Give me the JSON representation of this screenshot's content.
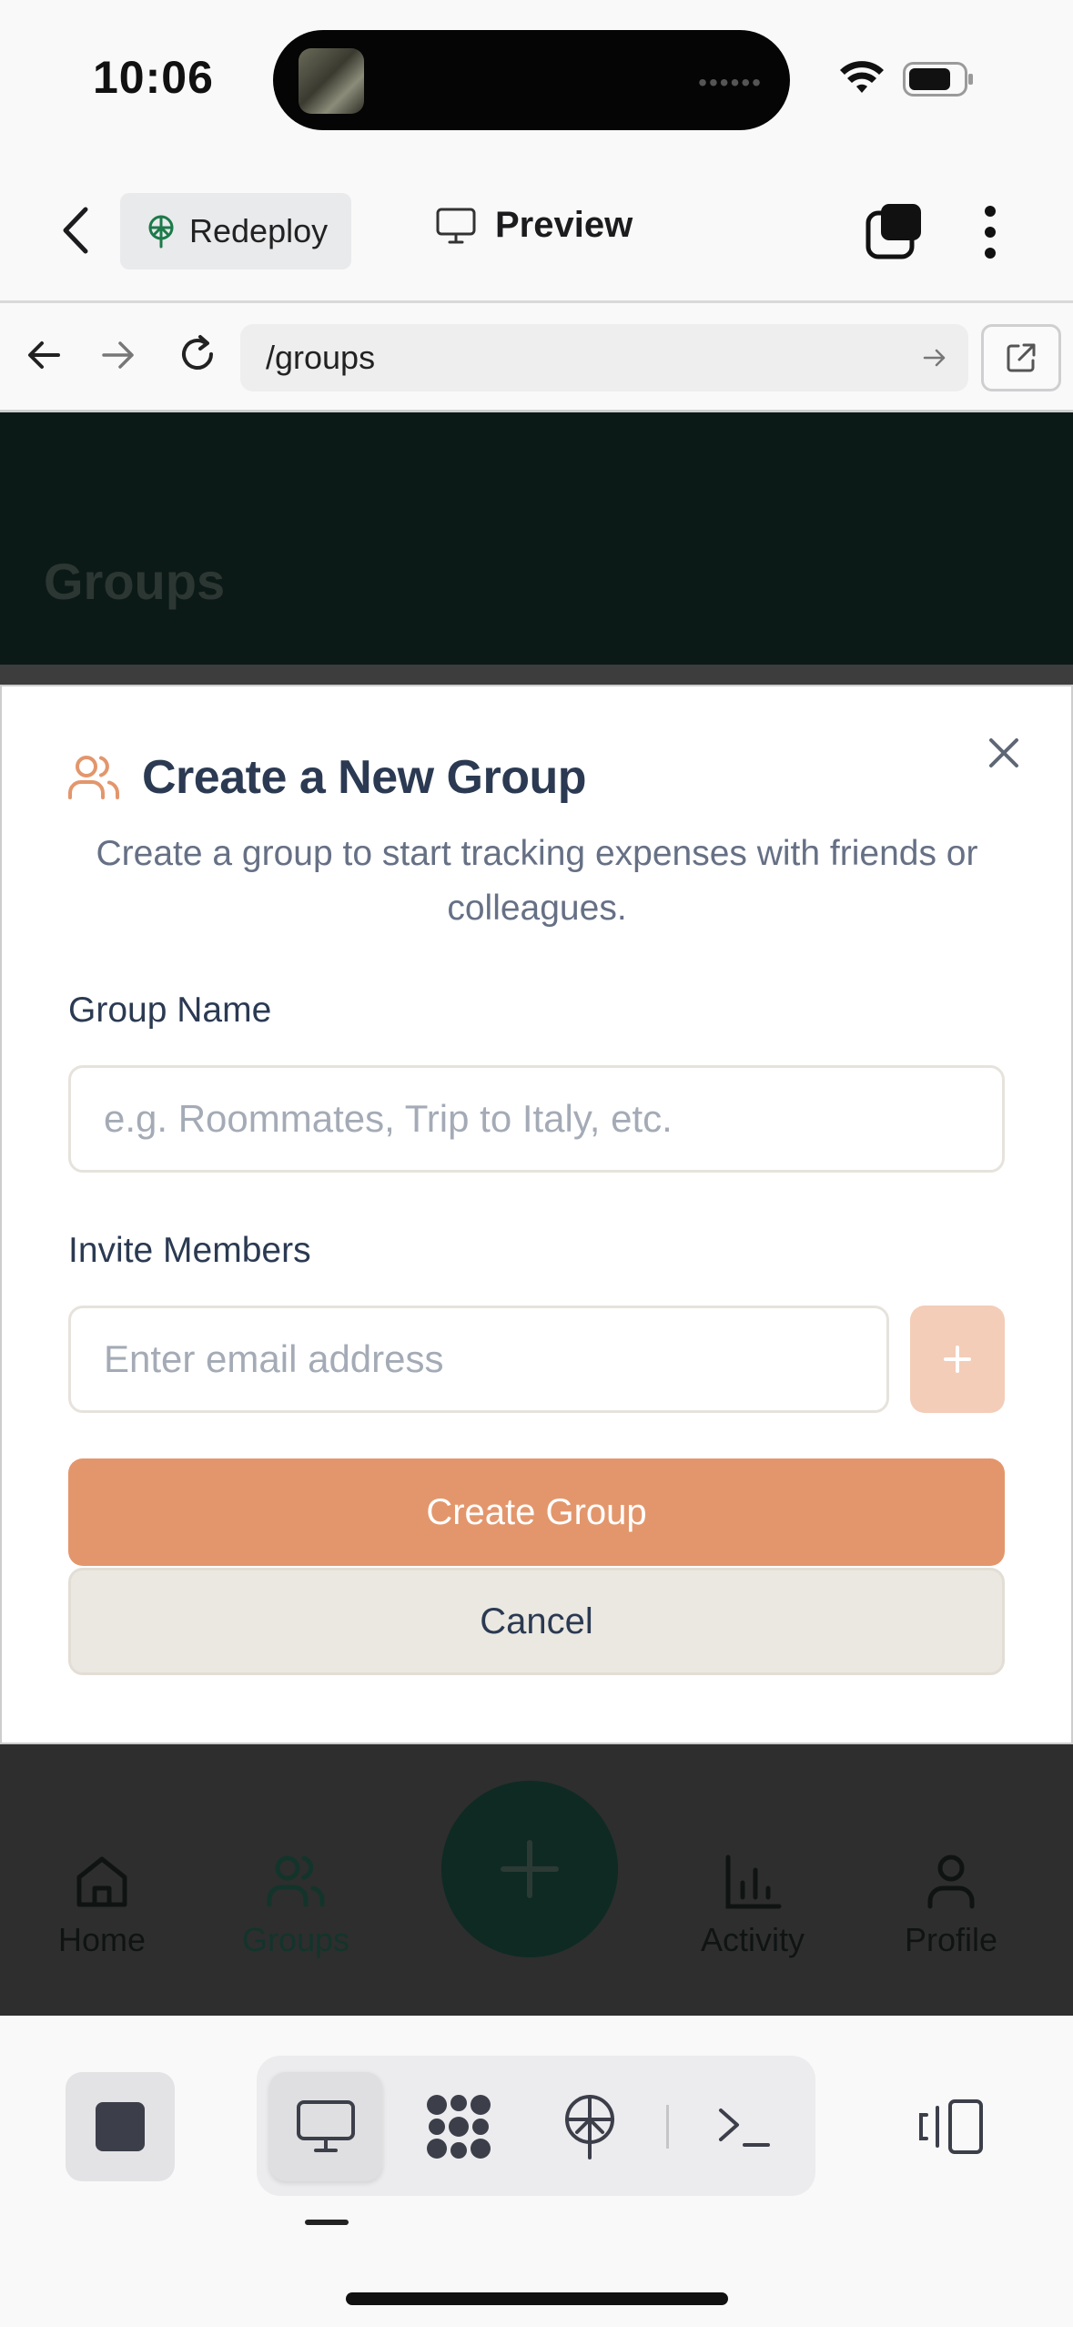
{
  "status_bar": {
    "time": "10:06"
  },
  "header": {
    "redeploy_label": "Redeploy",
    "preview_label": "Preview"
  },
  "browser": {
    "url": "/groups"
  },
  "page": {
    "title": "Groups"
  },
  "modal": {
    "title": "Create a New Group",
    "description": "Create a group to start tracking expenses with friends or colleagues.",
    "group_name_label": "Group Name",
    "group_name_placeholder": "e.g. Roommates, Trip to Italy, etc.",
    "invite_label": "Invite Members",
    "email_placeholder": "Enter email address",
    "create_label": "Create Group",
    "cancel_label": "Cancel"
  },
  "bottom_nav": {
    "items": [
      {
        "label": "Home",
        "icon": "home-icon"
      },
      {
        "label": "Groups",
        "icon": "users-icon",
        "active": true
      },
      {
        "label": "Activity",
        "icon": "bar-chart-icon"
      },
      {
        "label": "Profile",
        "icon": "user-icon"
      }
    ]
  },
  "colors": {
    "accent": "#e3966c",
    "accent_light": "#f3cdb8",
    "title_text": "#2b3a52",
    "hero_bg": "#0c1a17",
    "fab_bg": "#0e2a23"
  }
}
